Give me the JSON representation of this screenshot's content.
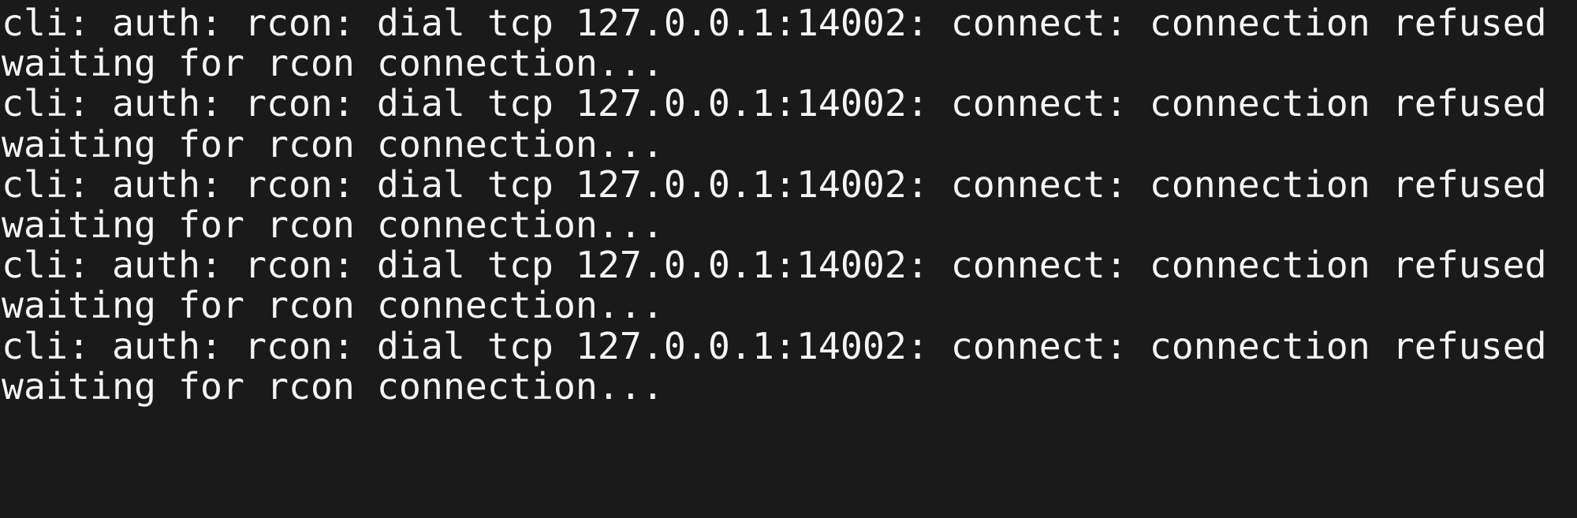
{
  "terminal": {
    "background_color": "#1a1a1a",
    "text_color": "#f2f2f2",
    "columns": 71,
    "rows": 10,
    "lines": [
      {
        "kind": "error",
        "text": "cli: auth: rcon: dial tcp 127.0.0.1:14002: connect: connection refused"
      },
      {
        "kind": "status",
        "text": "waiting for rcon connection..."
      },
      {
        "kind": "error",
        "text": "cli: auth: rcon: dial tcp 127.0.0.1:14002: connect: connection refused"
      },
      {
        "kind": "status",
        "text": "waiting for rcon connection..."
      },
      {
        "kind": "error",
        "text": "cli: auth: rcon: dial tcp 127.0.0.1:14002: connect: connection refused"
      },
      {
        "kind": "status",
        "text": "waiting for rcon connection..."
      },
      {
        "kind": "error",
        "text": "cli: auth: rcon: dial tcp 127.0.0.1:14002: connect: connection refused"
      },
      {
        "kind": "status",
        "text": "waiting for rcon connection..."
      },
      {
        "kind": "error",
        "text": "cli: auth: rcon: dial tcp 127.0.0.1:14002: connect: connection refused"
      },
      {
        "kind": "status",
        "text": "waiting for rcon connection..."
      }
    ]
  }
}
